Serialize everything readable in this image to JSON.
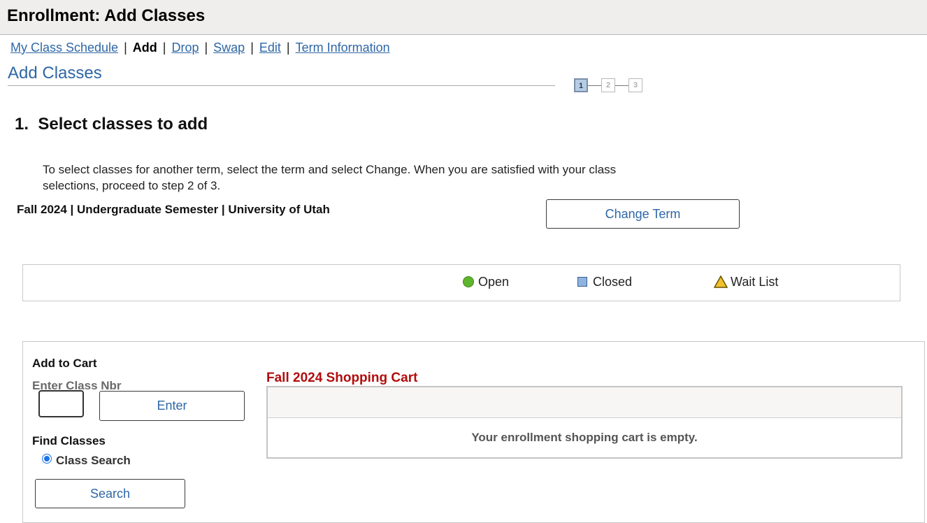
{
  "header": {
    "title": "Enrollment: Add Classes"
  },
  "nav": {
    "items": [
      {
        "label": "My Class Schedule",
        "current": false
      },
      {
        "label": "Add",
        "current": true
      },
      {
        "label": "Drop",
        "current": false
      },
      {
        "label": "Swap",
        "current": false
      },
      {
        "label": "Edit",
        "current": false
      },
      {
        "label": "Term Information",
        "current": false
      }
    ],
    "separator": "|"
  },
  "page_title": "Add Classes",
  "steps": {
    "labels": [
      "1",
      "2",
      "3"
    ],
    "current": 1
  },
  "section_heading": "1.  Select classes to add",
  "instructions": "To select classes for another term, select the term and select Change.  When you are satisfied with your class selections, proceed to step 2 of 3.",
  "term_line": "Fall 2024 | Undergraduate Semester | University of Utah",
  "change_term_label": "Change Term",
  "legend": {
    "open_label": "Open",
    "closed_label": "Closed",
    "waitlist_label": "Wait List",
    "open_icon": "green-circle-icon",
    "closed_icon": "blue-square-icon",
    "waitlist_icon": "yellow-triangle-icon"
  },
  "add_to_cart": {
    "heading": "Add to Cart",
    "class_nbr_label": "Enter Class Nbr",
    "class_nbr_value": "",
    "enter_label": "Enter",
    "find_heading": "Find Classes",
    "class_search_option": "Class Search",
    "search_label": "Search"
  },
  "cart": {
    "title": "Fall 2024 Shopping Cart",
    "empty_message": "Your enrollment shopping cart is empty."
  },
  "colors": {
    "link": "#2e67a6",
    "cart_title": "#b30d0d",
    "header_bg": "#efeeed"
  }
}
